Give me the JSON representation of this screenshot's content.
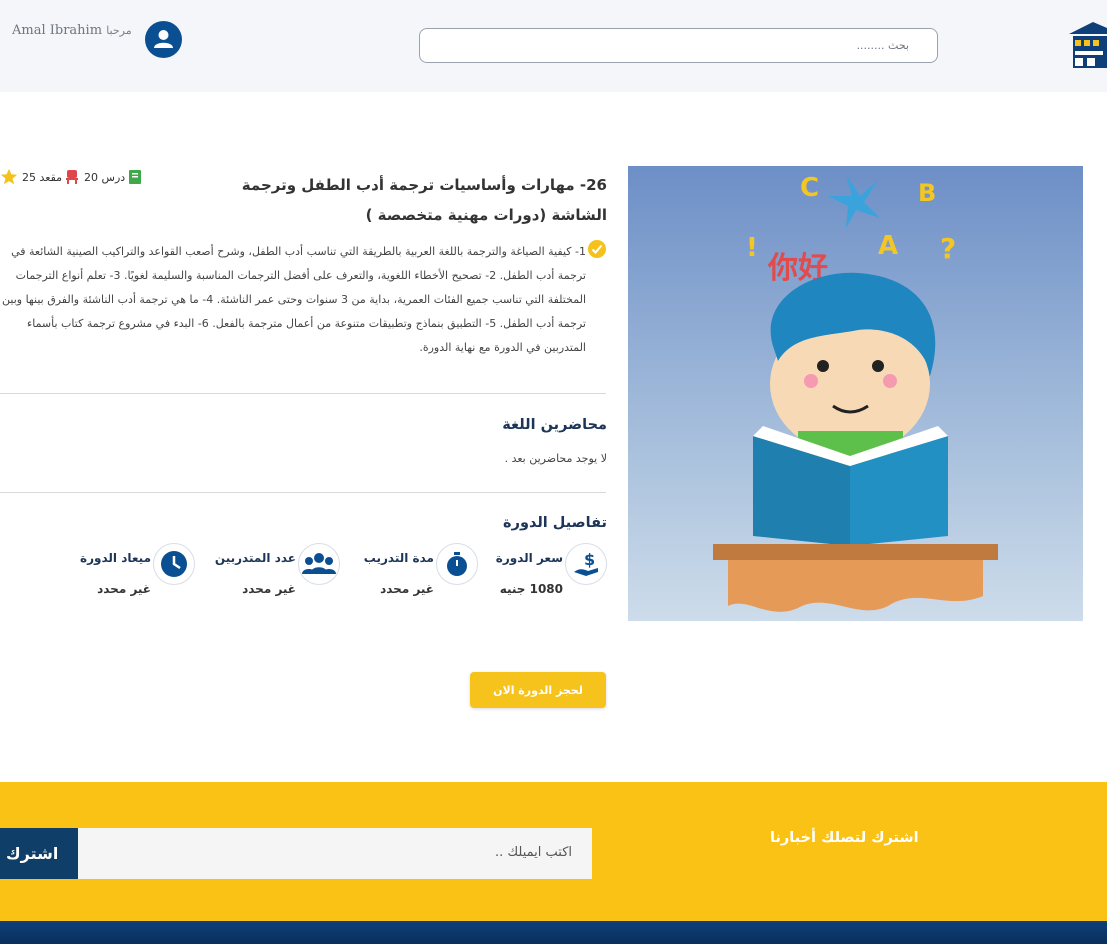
{
  "header": {
    "search_placeholder": "بحث ........",
    "greeting": "مرحبا",
    "user_name": "Amal Ibrahim"
  },
  "course": {
    "title": "26- مهارات وأساسيات ترجمة أدب الطفل وترجمة الشاشة (دورات مهنية متخصصة )",
    "lessons": "20 درس",
    "seats": "25 مقعد",
    "description": "1- كيفية الصياغة والترجمة باللغة العربية بالطريقة التي تناسب أدب الطفل، وشرح أصعب القواعد والتراكيب الصينية الشائعة في ترجمة أدب الطفل. 2- تصحيح الأخطاء اللغوية، والتعرف على أفضل الترجمات المناسبة والسليمة لغويًا. 3- تعلم أنواع الترجمات المختلفة التي تناسب جميع الفئات العمرية، بداية من 3 سنوات وحتى عمر الناشئة. 4- ما هي ترجمة أدب الناشئة والفرق بينها وبين ترجمة أدب الطفل. 5- التطبيق بنماذج وتطبيقات متنوعة من أعمال مترجمة بالفعل. 6- البدء في مشروع ترجمة كتاب بأسماء المتدربين في الدورة مع نهاية الدورة."
  },
  "lecturers": {
    "title": "محاضرين اللغة",
    "empty": "لا يوجد محاضرين بعد ."
  },
  "details": {
    "title": "تفاصيل الدورة",
    "price_label": "سعر الدورة",
    "price_value": "1080 جنيه",
    "duration_label": "مدة التدريب",
    "duration_value": "غير محدد",
    "trainees_label": "عدد المتدربين",
    "trainees_value": "غير محدد",
    "schedule_label": "ميعاد الدورة",
    "schedule_value": "غير محدد"
  },
  "book_button": "لحجز الدورة الان",
  "newsletter": {
    "title": "اشترك لتصلك أخبارنا",
    "email_placeholder": "اكتب ايميلك ..",
    "subscribe": "اشترك"
  },
  "colors": {
    "primary": "#0b4f93",
    "accent": "#fbc216",
    "dark_button": "#0f3f68"
  },
  "icons": {
    "avatar": "user-icon",
    "lessons": "book-icon",
    "seats": "chair-icon",
    "rating": "star-icon",
    "price": "hand-dollar-icon",
    "duration": "stopwatch-icon",
    "trainees": "group-icon",
    "schedule": "clock-icon"
  }
}
